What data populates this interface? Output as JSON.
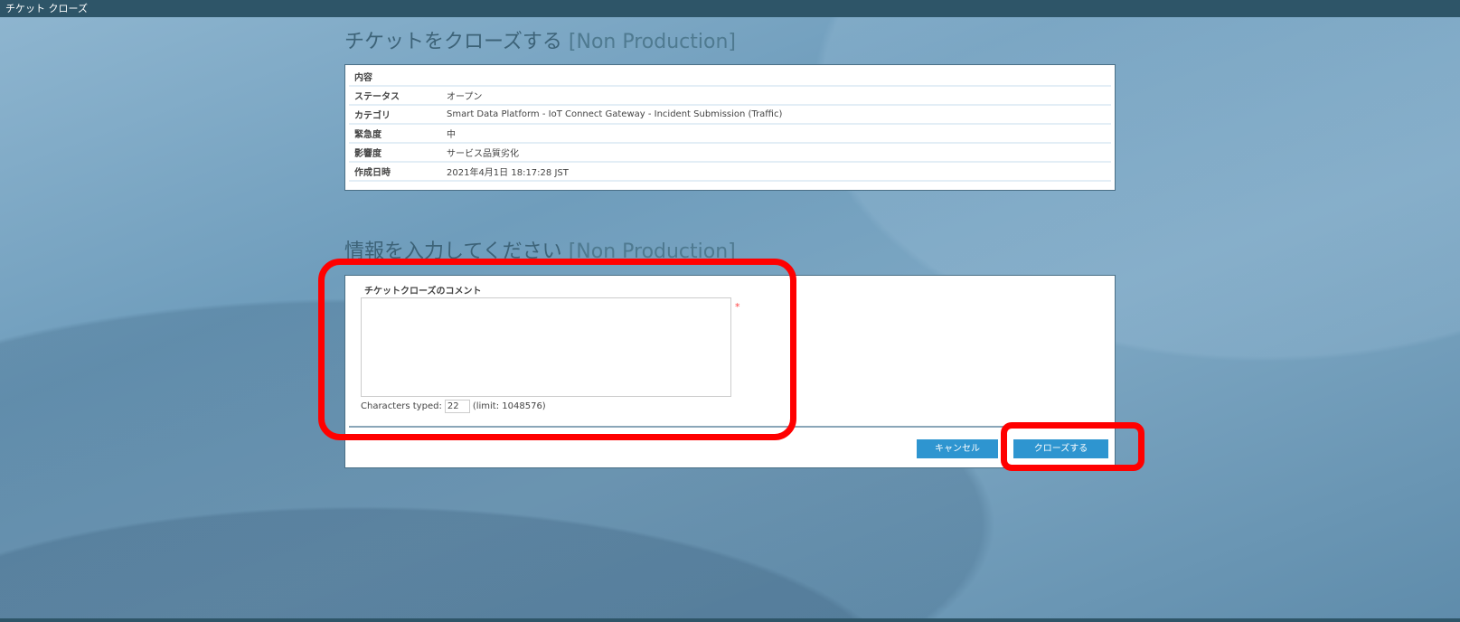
{
  "window": {
    "title": "チケット クローズ"
  },
  "section1": {
    "title": "チケットをクローズする",
    "env": "[Non Production]"
  },
  "details": {
    "header": "内容",
    "rows": [
      {
        "label": "ステータス",
        "value": "オープン"
      },
      {
        "label": "カテゴリ",
        "value": "Smart Data Platform - IoT Connect Gateway - Incident Submission (Traffic)"
      },
      {
        "label": "緊急度",
        "value": "中"
      },
      {
        "label": "影響度",
        "value": "サービス品質劣化"
      },
      {
        "label": "作成日時",
        "value": "2021年4月1日 18:17:28 JST"
      }
    ]
  },
  "section2": {
    "title": "情報を入力してください",
    "env": "[Non Production]"
  },
  "form": {
    "comment_label": "チケットクローズのコメント",
    "comment_value": "",
    "required_mark": "*",
    "chars_label": "Characters typed:",
    "chars_count": "22",
    "limit": "(limit: 1048576)"
  },
  "buttons": {
    "cancel": "キャンセル",
    "close": "クローズする"
  },
  "colors": {
    "titlebar": "#2e5568",
    "button": "#2e95d0",
    "highlight": "#ff0000"
  }
}
